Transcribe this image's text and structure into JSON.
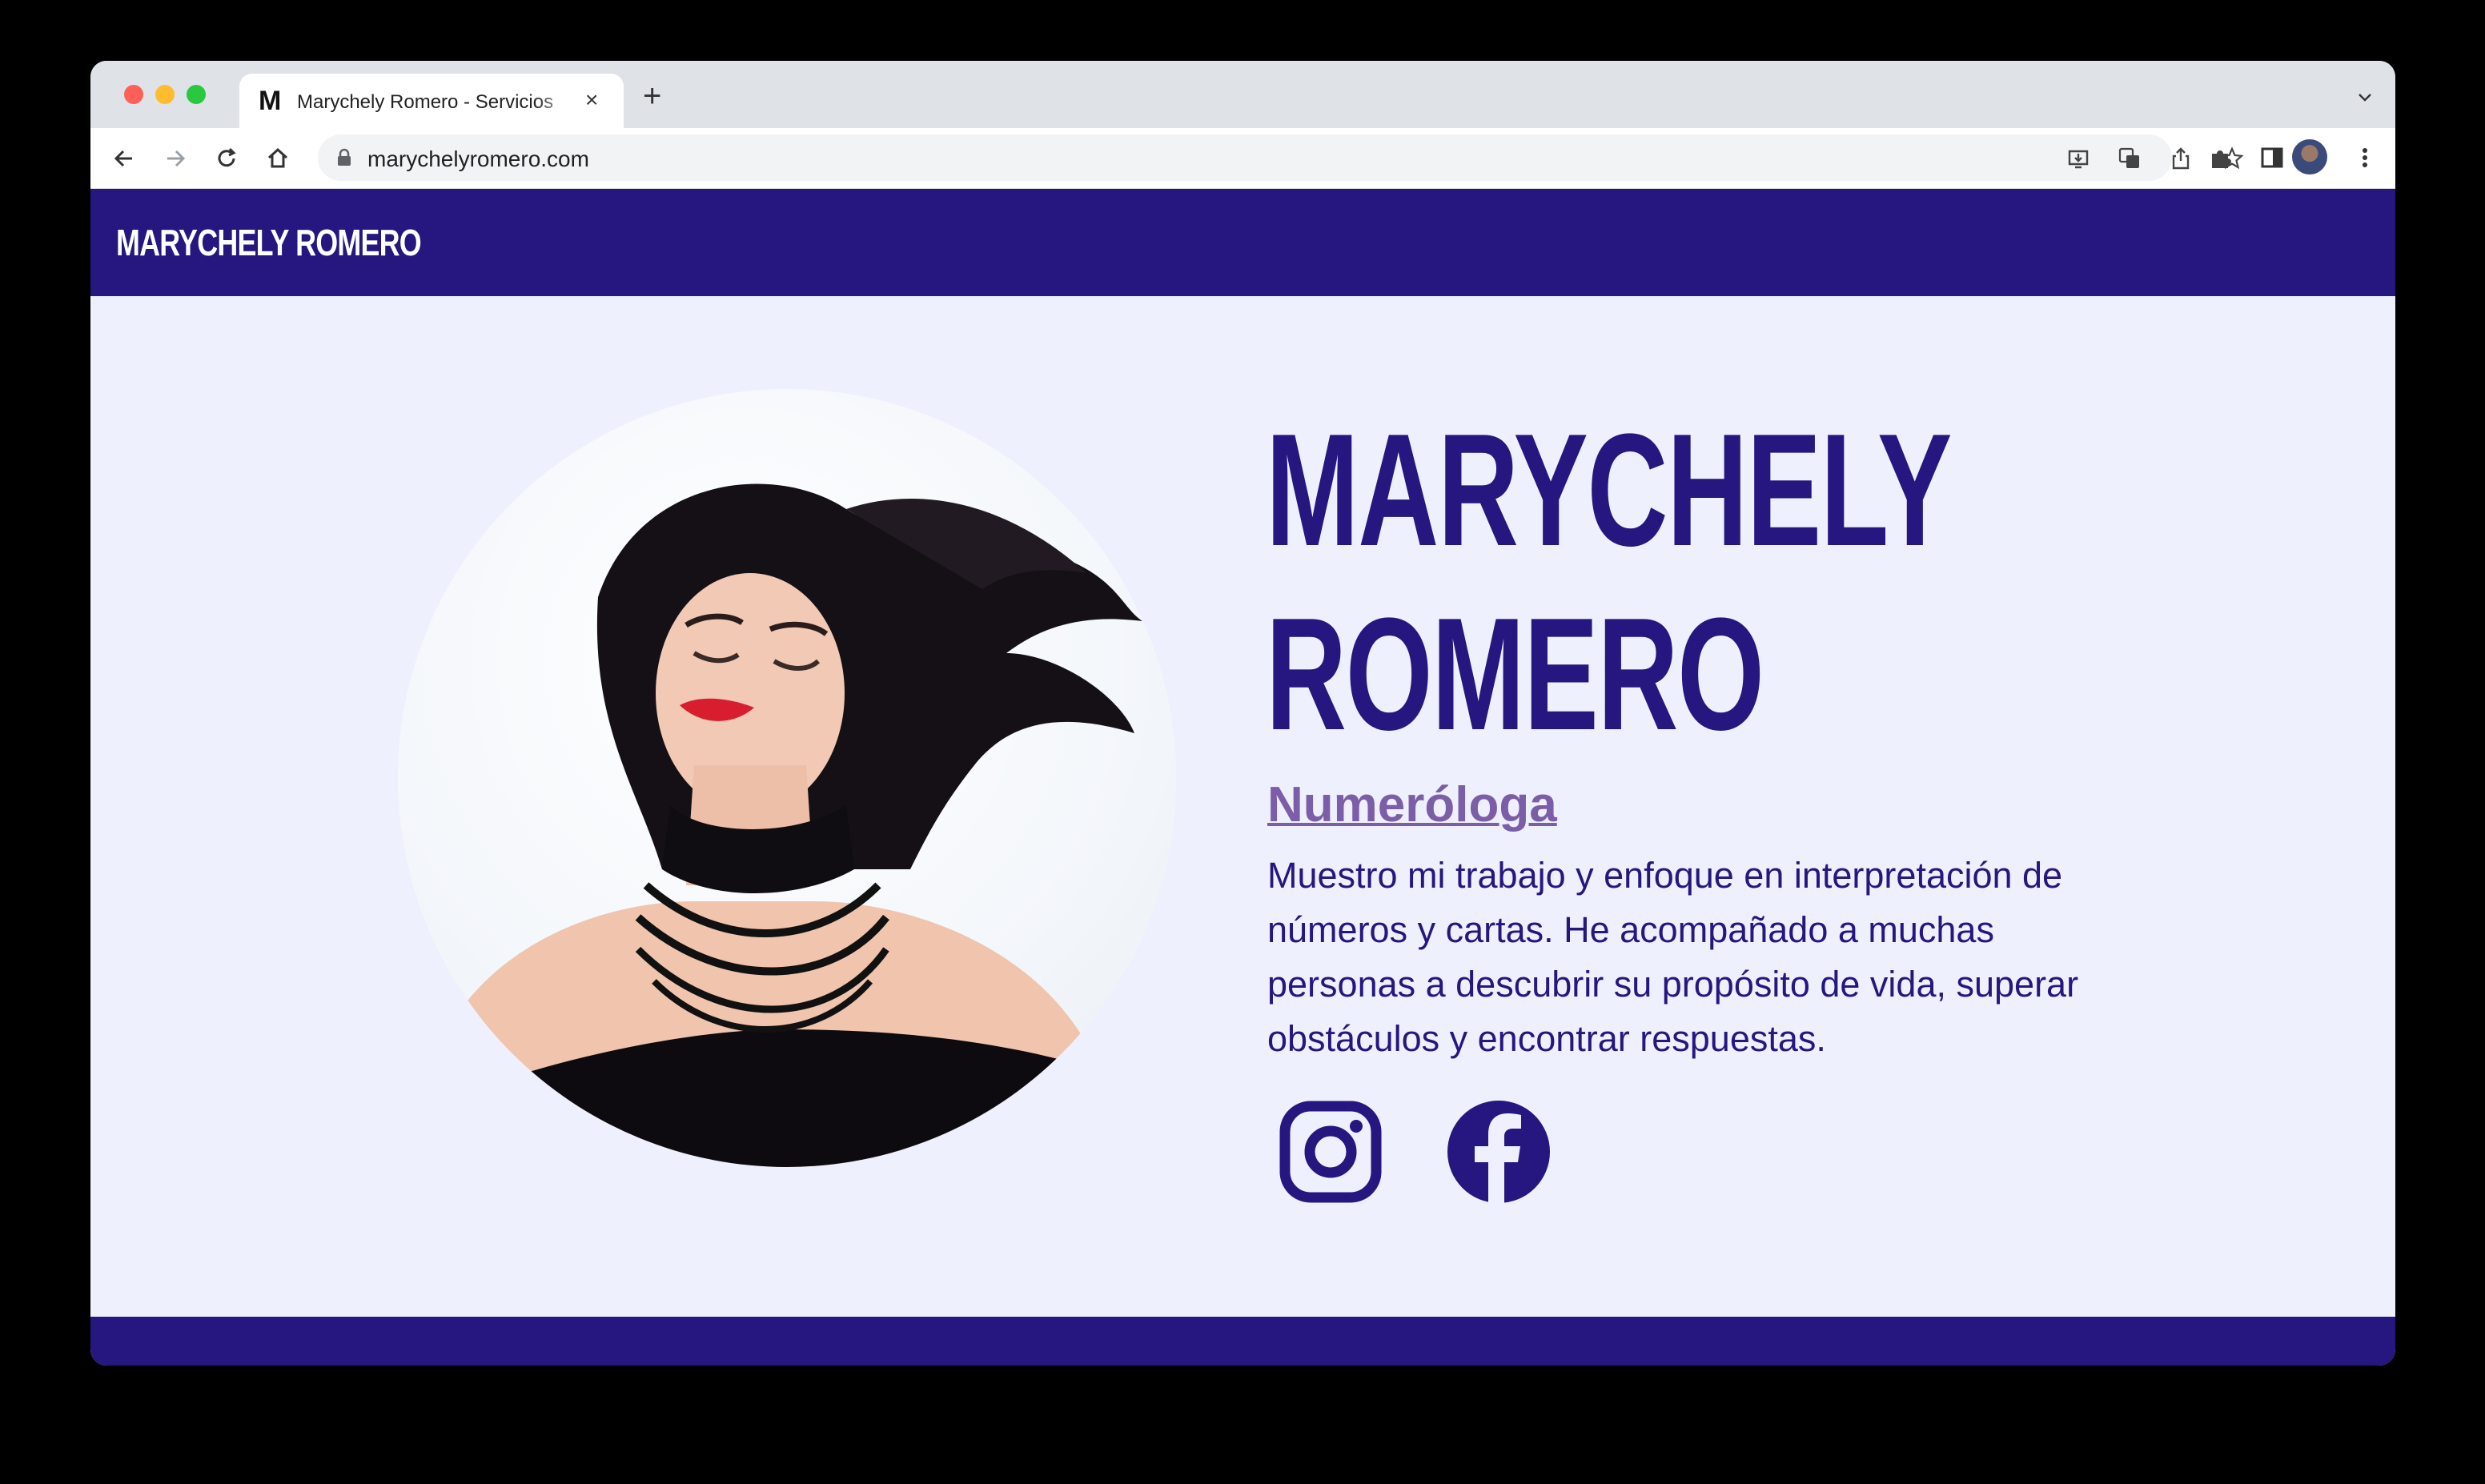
{
  "browser": {
    "tab_title": "Marychely Romero - Servicios",
    "tab_favicon": "M",
    "tab_close_glyph": "×",
    "new_tab_glyph": "+",
    "url": "marychelyromero.com"
  },
  "site": {
    "logo": "MARYCHELY ROMERO",
    "hero_name_line1": "MARYCHELY",
    "hero_name_line2": "ROMERO",
    "subtitle": "Numeróloga",
    "bio": "Muestro mi trabajo y enfoque en interpretación de números y cartas. He acompañado a muchas personas a descubrir su propósito de vida, superar obstáculos y encontrar respuestas.",
    "social": [
      {
        "icon": "instagram-icon"
      },
      {
        "icon": "facebook-icon"
      }
    ]
  },
  "colors": {
    "brand": "#25177f",
    "accent": "#7b5ea7",
    "page_bg": "#eef1fd"
  }
}
